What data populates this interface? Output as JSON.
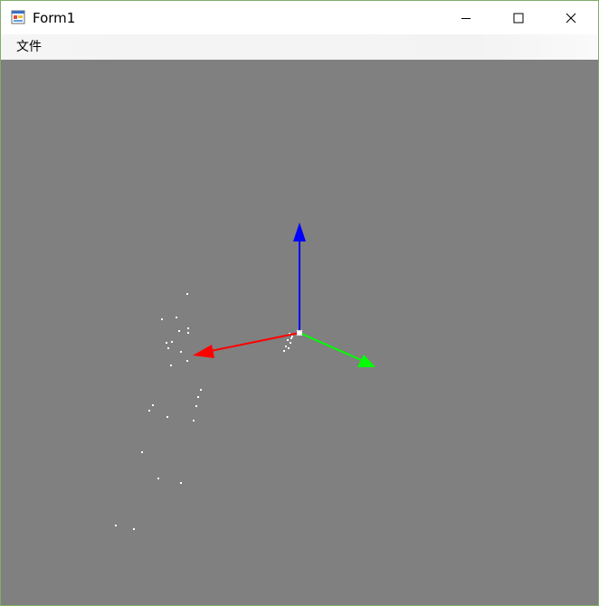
{
  "window": {
    "title": "Form1"
  },
  "menu": {
    "items": [
      {
        "label": "文件"
      }
    ]
  },
  "scene": {
    "background_color": "#808080",
    "point_color": "#ffffff",
    "axes": {
      "x_color": "#ff0000",
      "y_color": "#00ff00",
      "z_color": "#0000ff"
    }
  }
}
